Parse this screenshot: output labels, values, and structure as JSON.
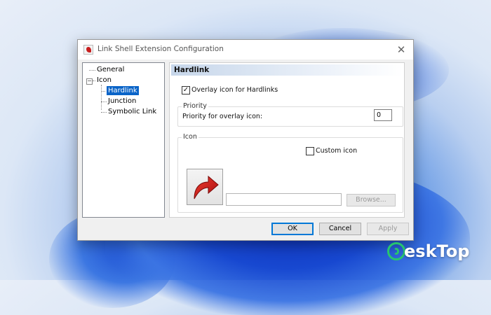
{
  "window": {
    "title": "Link Shell Extension Configuration",
    "close_glyph": "✕",
    "app_icon": "link-shell-extension-icon"
  },
  "tree": {
    "items": [
      {
        "label": "General"
      },
      {
        "label": "Icon",
        "expander": "−"
      },
      {
        "label": "Hardlink",
        "selected": true
      },
      {
        "label": "Junction"
      },
      {
        "label": "Symbolic Link"
      }
    ]
  },
  "panel": {
    "header": "Hardlink",
    "overlay_checkbox": {
      "label": "Overlay icon for Hardlinks",
      "checked": true,
      "glyph": "✓"
    },
    "priority_group": {
      "title": "Priority",
      "label": "Priority for overlay icon:",
      "value": "0"
    },
    "icon_group": {
      "title": "Icon",
      "custom_checkbox": {
        "label": "Custom icon",
        "checked": false
      },
      "path_value": "",
      "browse_label": "Browse..."
    }
  },
  "buttons": {
    "ok": "OK",
    "cancel": "Cancel",
    "apply": "Apply"
  },
  "watermark": {
    "text": "eskTop"
  },
  "colors": {
    "selection": "#0a64c8",
    "accent_red": "#c81d1d",
    "watermark_green": "#27c56e"
  }
}
